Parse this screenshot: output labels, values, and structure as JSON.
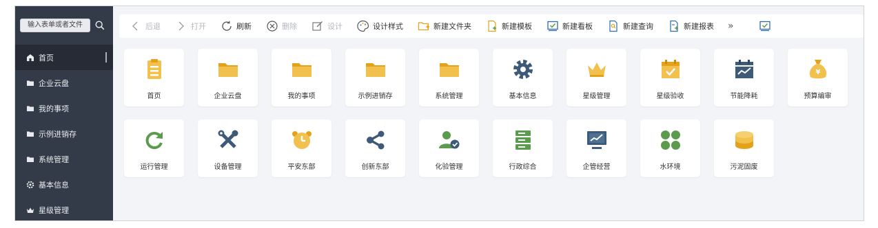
{
  "sidebar": {
    "search_placeholder": "输入表单或者文件",
    "items": [
      {
        "label": "首页",
        "icon": "home-icon",
        "active": true
      },
      {
        "label": "企业云盘",
        "icon": "folder-icon"
      },
      {
        "label": "我的事项",
        "icon": "folder-icon"
      },
      {
        "label": "示例进销存",
        "icon": "folder-icon"
      },
      {
        "label": "系统管理",
        "icon": "folder-icon"
      },
      {
        "label": "基本信息",
        "icon": "gear-icon"
      },
      {
        "label": "星级管理",
        "icon": "crown-icon"
      }
    ]
  },
  "toolbar": {
    "back": "后退",
    "open": "打开",
    "refresh": "刷新",
    "delete": "删除",
    "design": "设计",
    "design_style": "设计样式",
    "new_folder": "新建文件夹",
    "new_template": "新建模板",
    "new_board": "新建看板",
    "new_query": "新建查询",
    "new_report": "新建报表",
    "more": "»"
  },
  "tiles": [
    {
      "label": "首页",
      "icon": "clipboard-icon"
    },
    {
      "label": "企业云盘",
      "icon": "folder-icon"
    },
    {
      "label": "我的事项",
      "icon": "folder-icon"
    },
    {
      "label": "示例进销存",
      "icon": "folder-icon"
    },
    {
      "label": "系统管理",
      "icon": "folder-icon"
    },
    {
      "label": "基本信息",
      "icon": "gear-icon"
    },
    {
      "label": "星级管理",
      "icon": "crown-icon"
    },
    {
      "label": "星级验收",
      "icon": "calendar-check-icon"
    },
    {
      "label": "节能降耗",
      "icon": "chart-calendar-icon"
    },
    {
      "label": "预算编审",
      "icon": "money-bag-icon"
    },
    {
      "label": "运行管理",
      "icon": "refresh-cycle-icon"
    },
    {
      "label": "设备管理",
      "icon": "tools-icon"
    },
    {
      "label": "平安东部",
      "icon": "alarm-clock-icon"
    },
    {
      "label": "创新东部",
      "icon": "share-nodes-icon"
    },
    {
      "label": "化验管理",
      "icon": "user-check-icon"
    },
    {
      "label": "行政综合",
      "icon": "server-icon"
    },
    {
      "label": "企管经营",
      "icon": "monitor-chart-icon"
    },
    {
      "label": "水环境",
      "icon": "clover-icon"
    },
    {
      "label": "污泥固废",
      "icon": "coins-icon"
    }
  ],
  "colors": {
    "sidebar_bg": "#343b48",
    "accent_yellow": "#f2c04c",
    "icon_dark": "#3d5a78",
    "icon_green": "#5a9b4e"
  }
}
